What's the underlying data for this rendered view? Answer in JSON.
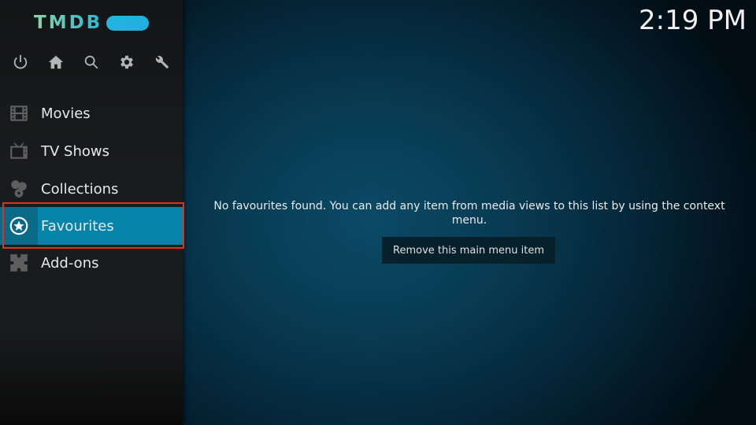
{
  "app": {
    "logo_text": "TMDB",
    "accent_color": "#0384a8",
    "highlight_color": "#e0301e"
  },
  "header": {
    "clock": "2:19 PM"
  },
  "top_icons": [
    {
      "name": "power-icon"
    },
    {
      "name": "home-icon"
    },
    {
      "name": "search-icon"
    },
    {
      "name": "settings-gear-icon"
    },
    {
      "name": "wrench-icon"
    }
  ],
  "sidebar": {
    "items": [
      {
        "label": "Movies",
        "icon": "film-icon",
        "active": false
      },
      {
        "label": "TV Shows",
        "icon": "tv-icon",
        "active": false
      },
      {
        "label": "Collections",
        "icon": "collections-icon",
        "active": false
      },
      {
        "label": "Favourites",
        "icon": "star-circle-icon",
        "active": true
      },
      {
        "label": "Add-ons",
        "icon": "puzzle-icon",
        "active": false
      }
    ]
  },
  "main": {
    "empty_message": "No favourites found. You can add any item from media views to this list by using the context menu.",
    "remove_button_label": "Remove this main menu item"
  }
}
